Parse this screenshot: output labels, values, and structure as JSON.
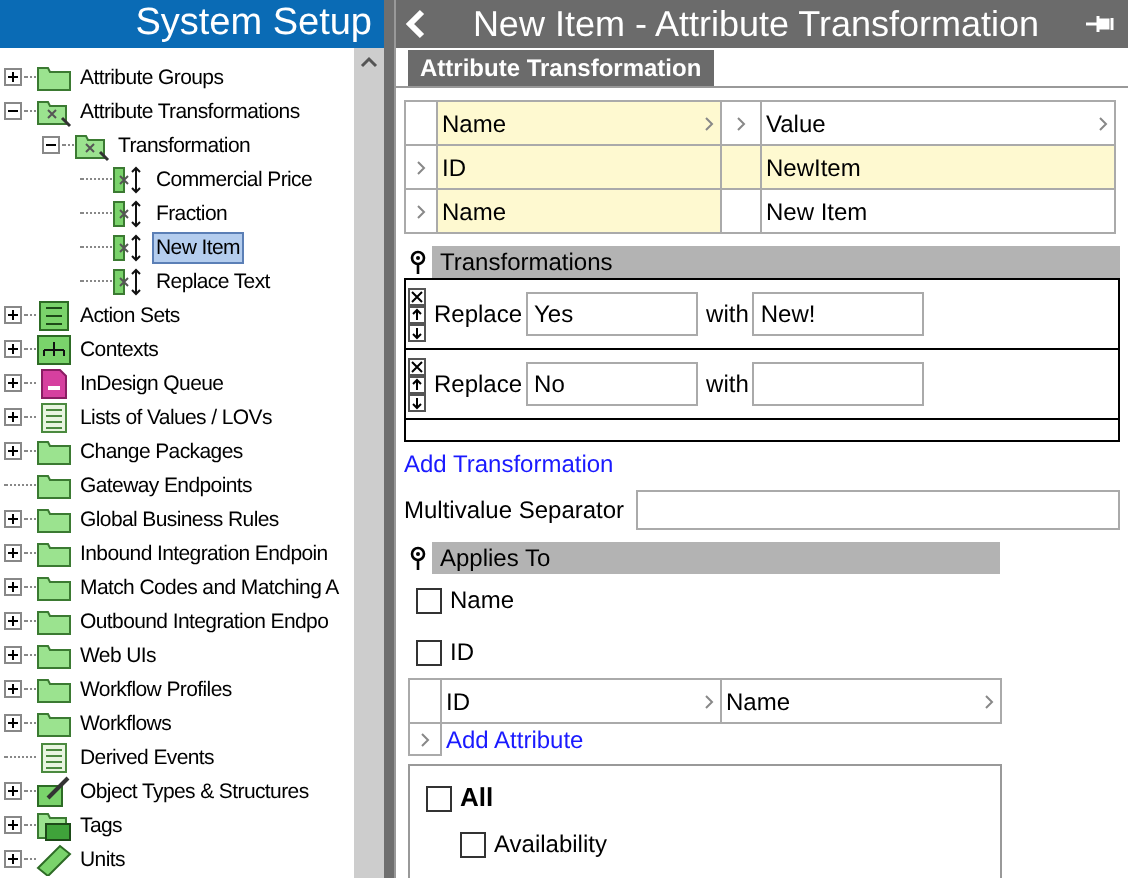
{
  "sidebar": {
    "title": "System Setup",
    "tree": [
      {
        "label": "Attribute Groups",
        "kind": "folder",
        "expanded": false,
        "selected": false
      },
      {
        "label": "Attribute Transformations",
        "kind": "transform-folder",
        "expanded": true,
        "selected": false,
        "children": [
          {
            "label": "Transformation",
            "kind": "transform-folder",
            "expanded": true,
            "selected": false,
            "children": [
              {
                "label": "Commercial Price",
                "kind": "transform",
                "selected": false
              },
              {
                "label": "Fraction",
                "kind": "transform",
                "selected": false
              },
              {
                "label": "New Item",
                "kind": "transform",
                "selected": true
              },
              {
                "label": "Replace Text",
                "kind": "transform",
                "selected": false
              }
            ]
          }
        ]
      },
      {
        "label": "Action Sets",
        "kind": "checklist",
        "expanded": false,
        "selected": false
      },
      {
        "label": "Contexts",
        "kind": "hierarchy",
        "expanded": false,
        "selected": false
      },
      {
        "label": "InDesign Queue",
        "kind": "document",
        "expanded": false,
        "selected": false
      },
      {
        "label": "Lists of Values / LOVs",
        "kind": "list",
        "expanded": false,
        "selected": false
      },
      {
        "label": "Change Packages",
        "kind": "folder",
        "expanded": false,
        "selected": false
      },
      {
        "label": "Gateway Endpoints",
        "kind": "folder",
        "selected": false
      },
      {
        "label": "Global Business Rules",
        "kind": "folder",
        "expanded": false,
        "selected": false
      },
      {
        "label": "Inbound Integration Endpoin",
        "kind": "folder",
        "expanded": false,
        "selected": false
      },
      {
        "label": "Match Codes and Matching A",
        "kind": "folder",
        "expanded": false,
        "selected": false
      },
      {
        "label": "Outbound Integration Endpo",
        "kind": "folder",
        "expanded": false,
        "selected": false
      },
      {
        "label": "Web UIs",
        "kind": "folder",
        "expanded": false,
        "selected": false
      },
      {
        "label": "Workflow Profiles",
        "kind": "folder",
        "expanded": false,
        "selected": false
      },
      {
        "label": "Workflows",
        "kind": "folder",
        "expanded": false,
        "selected": false
      },
      {
        "label": "Derived Events",
        "kind": "list",
        "selected": false
      },
      {
        "label": "Object Types & Structures",
        "kind": "tools",
        "expanded": false,
        "selected": false
      },
      {
        "label": "Tags",
        "kind": "tag",
        "expanded": false,
        "selected": false
      },
      {
        "label": "Units",
        "kind": "ruler",
        "expanded": false,
        "selected": false
      }
    ]
  },
  "editor": {
    "title": "New Item - Attribute Transformation",
    "tabs": [
      {
        "label": "Attribute Transformation",
        "selected": true
      }
    ],
    "properties": {
      "columns": [
        "Name",
        "Value"
      ],
      "rows": [
        {
          "name": "ID",
          "value": "NewItem"
        },
        {
          "name": "Name",
          "value": "New Item"
        }
      ]
    },
    "transformations": {
      "title": "Transformations",
      "rows": [
        {
          "label": "Replace",
          "find": "Yes",
          "with_label": "with",
          "replace": "New!"
        },
        {
          "label": "Replace",
          "find": "No",
          "with_label": "with"
        }
      ],
      "add_link": "Add Transformation"
    },
    "separator": {
      "label": "Multivalue Separator"
    },
    "applies_to": {
      "title": "Applies To",
      "options": [
        {
          "label": "Name",
          "checked": false
        },
        {
          "label": "ID",
          "checked": false
        }
      ],
      "attribute_columns": [
        "ID",
        "Name"
      ],
      "add_link": "Add Attribute",
      "groups": [
        {
          "label": "All",
          "checked": false,
          "children": [
            {
              "label": "Availability",
              "checked": false
            }
          ]
        }
      ]
    }
  }
}
